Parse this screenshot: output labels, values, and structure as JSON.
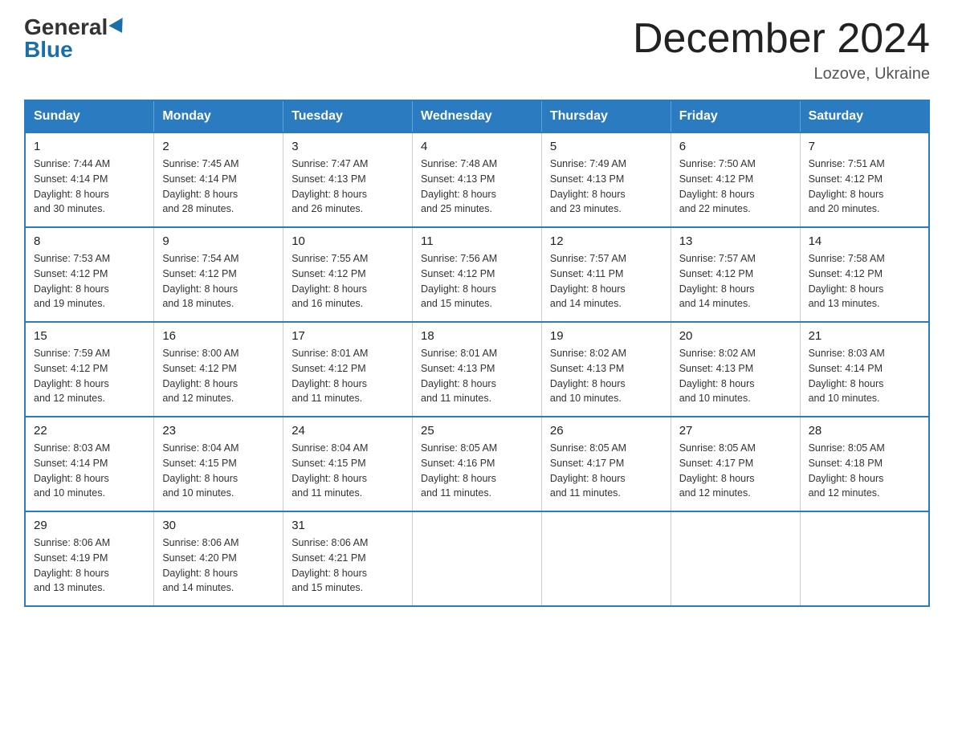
{
  "header": {
    "logo_general": "General",
    "logo_blue": "Blue",
    "month_title": "December 2024",
    "location": "Lozove, Ukraine"
  },
  "weekdays": [
    "Sunday",
    "Monday",
    "Tuesday",
    "Wednesday",
    "Thursday",
    "Friday",
    "Saturday"
  ],
  "weeks": [
    [
      {
        "day": "1",
        "sunrise": "7:44 AM",
        "sunset": "4:14 PM",
        "daylight": "8 hours and 30 minutes."
      },
      {
        "day": "2",
        "sunrise": "7:45 AM",
        "sunset": "4:14 PM",
        "daylight": "8 hours and 28 minutes."
      },
      {
        "day": "3",
        "sunrise": "7:47 AM",
        "sunset": "4:13 PM",
        "daylight": "8 hours and 26 minutes."
      },
      {
        "day": "4",
        "sunrise": "7:48 AM",
        "sunset": "4:13 PM",
        "daylight": "8 hours and 25 minutes."
      },
      {
        "day": "5",
        "sunrise": "7:49 AM",
        "sunset": "4:13 PM",
        "daylight": "8 hours and 23 minutes."
      },
      {
        "day": "6",
        "sunrise": "7:50 AM",
        "sunset": "4:12 PM",
        "daylight": "8 hours and 22 minutes."
      },
      {
        "day": "7",
        "sunrise": "7:51 AM",
        "sunset": "4:12 PM",
        "daylight": "8 hours and 20 minutes."
      }
    ],
    [
      {
        "day": "8",
        "sunrise": "7:53 AM",
        "sunset": "4:12 PM",
        "daylight": "8 hours and 19 minutes."
      },
      {
        "day": "9",
        "sunrise": "7:54 AM",
        "sunset": "4:12 PM",
        "daylight": "8 hours and 18 minutes."
      },
      {
        "day": "10",
        "sunrise": "7:55 AM",
        "sunset": "4:12 PM",
        "daylight": "8 hours and 16 minutes."
      },
      {
        "day": "11",
        "sunrise": "7:56 AM",
        "sunset": "4:12 PM",
        "daylight": "8 hours and 15 minutes."
      },
      {
        "day": "12",
        "sunrise": "7:57 AM",
        "sunset": "4:11 PM",
        "daylight": "8 hours and 14 minutes."
      },
      {
        "day": "13",
        "sunrise": "7:57 AM",
        "sunset": "4:12 PM",
        "daylight": "8 hours and 14 minutes."
      },
      {
        "day": "14",
        "sunrise": "7:58 AM",
        "sunset": "4:12 PM",
        "daylight": "8 hours and 13 minutes."
      }
    ],
    [
      {
        "day": "15",
        "sunrise": "7:59 AM",
        "sunset": "4:12 PM",
        "daylight": "8 hours and 12 minutes."
      },
      {
        "day": "16",
        "sunrise": "8:00 AM",
        "sunset": "4:12 PM",
        "daylight": "8 hours and 12 minutes."
      },
      {
        "day": "17",
        "sunrise": "8:01 AM",
        "sunset": "4:12 PM",
        "daylight": "8 hours and 11 minutes."
      },
      {
        "day": "18",
        "sunrise": "8:01 AM",
        "sunset": "4:13 PM",
        "daylight": "8 hours and 11 minutes."
      },
      {
        "day": "19",
        "sunrise": "8:02 AM",
        "sunset": "4:13 PM",
        "daylight": "8 hours and 10 minutes."
      },
      {
        "day": "20",
        "sunrise": "8:02 AM",
        "sunset": "4:13 PM",
        "daylight": "8 hours and 10 minutes."
      },
      {
        "day": "21",
        "sunrise": "8:03 AM",
        "sunset": "4:14 PM",
        "daylight": "8 hours and 10 minutes."
      }
    ],
    [
      {
        "day": "22",
        "sunrise": "8:03 AM",
        "sunset": "4:14 PM",
        "daylight": "8 hours and 10 minutes."
      },
      {
        "day": "23",
        "sunrise": "8:04 AM",
        "sunset": "4:15 PM",
        "daylight": "8 hours and 10 minutes."
      },
      {
        "day": "24",
        "sunrise": "8:04 AM",
        "sunset": "4:15 PM",
        "daylight": "8 hours and 11 minutes."
      },
      {
        "day": "25",
        "sunrise": "8:05 AM",
        "sunset": "4:16 PM",
        "daylight": "8 hours and 11 minutes."
      },
      {
        "day": "26",
        "sunrise": "8:05 AM",
        "sunset": "4:17 PM",
        "daylight": "8 hours and 11 minutes."
      },
      {
        "day": "27",
        "sunrise": "8:05 AM",
        "sunset": "4:17 PM",
        "daylight": "8 hours and 12 minutes."
      },
      {
        "day": "28",
        "sunrise": "8:05 AM",
        "sunset": "4:18 PM",
        "daylight": "8 hours and 12 minutes."
      }
    ],
    [
      {
        "day": "29",
        "sunrise": "8:06 AM",
        "sunset": "4:19 PM",
        "daylight": "8 hours and 13 minutes."
      },
      {
        "day": "30",
        "sunrise": "8:06 AM",
        "sunset": "4:20 PM",
        "daylight": "8 hours and 14 minutes."
      },
      {
        "day": "31",
        "sunrise": "8:06 AM",
        "sunset": "4:21 PM",
        "daylight": "8 hours and 15 minutes."
      },
      null,
      null,
      null,
      null
    ]
  ],
  "labels": {
    "sunrise": "Sunrise:",
    "sunset": "Sunset:",
    "daylight": "Daylight:"
  }
}
